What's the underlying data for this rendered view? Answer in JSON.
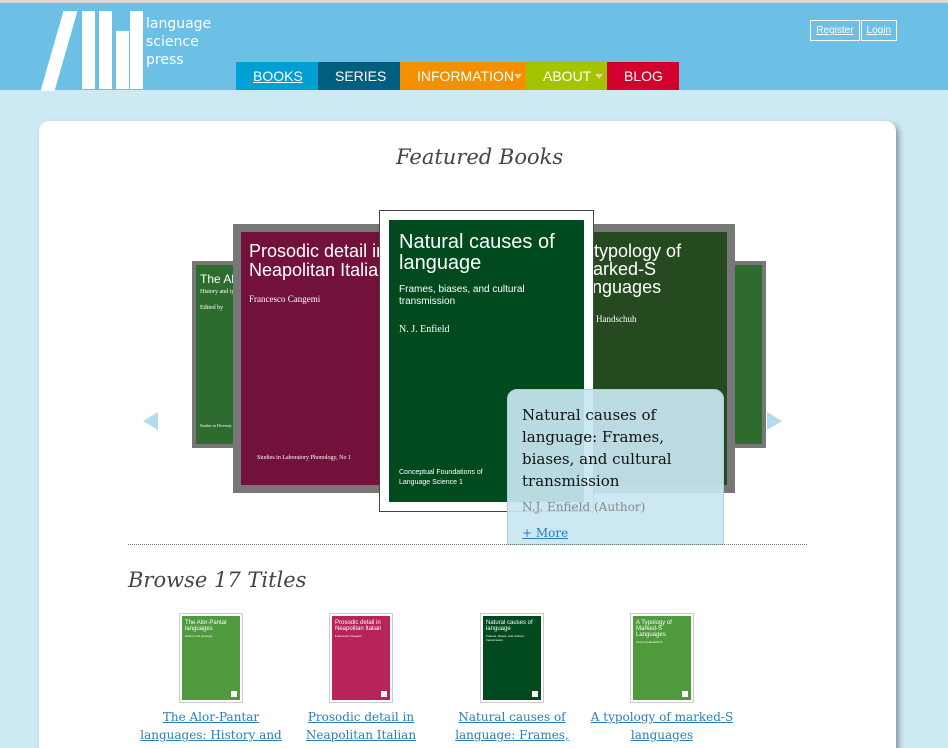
{
  "brand": {
    "line1": "language",
    "line2": "science",
    "line3": "press"
  },
  "account": {
    "register": "Register",
    "login": "Login"
  },
  "nav": [
    {
      "label": "BOOKS",
      "color": "#009fd4",
      "active": true
    },
    {
      "label": "SERIES",
      "color": "#005f7f"
    },
    {
      "label": "INFORMATION",
      "color": "#f39000"
    },
    {
      "label": "ABOUT",
      "color": "#a5c400"
    },
    {
      "label": "BLOG",
      "color": "#d3002d"
    }
  ],
  "featured": {
    "title": "Featured Books",
    "books": [
      {
        "title": "The Alor-Pantar languages",
        "subtitle": "History and typology",
        "editor": "Edited by",
        "series": "Studies in Diversity",
        "color": "#2e6b2e"
      },
      {
        "title": "Prosodic detail in Neapolitan Italian",
        "author": "Francesco Cangemi",
        "series": "Studies in Laboratory Phonology, No 1",
        "color": "#72123a"
      },
      {
        "title": "Natural causes of language",
        "subtitle": "Frames, biases, and cultural transmission",
        "author": "N. J. Enfield",
        "series": "Conceptual Foundations of Language Science 1",
        "color": "#004a1e"
      },
      {
        "title": "A typology of Marked-S languages",
        "author": "Handschuh",
        "color": "#264a20"
      },
      {
        "color": "#2e6b2e"
      }
    ],
    "tooltip": {
      "title": "Natural causes of language: Frames, biases, and cultural transmission",
      "author": "N.J. Enfield (Author)",
      "more": "+ More"
    }
  },
  "browse": {
    "title": "Browse 17 Titles",
    "items": [
      {
        "cover_title": "The Alor-Pantar languages",
        "cover_sub": "History and typology",
        "link": "The Alor-Pantar languages: History and",
        "color": "#4f9a3c"
      },
      {
        "cover_title": "Prosodic detail in Neapolitan Italian",
        "cover_sub": "Francesco Cangemi",
        "link": "Prosodic detail in Neapolitan Italian",
        "color": "#b8245a"
      },
      {
        "cover_title": "Natural causes of language",
        "cover_sub": "Frames, biases, and cultural transmission",
        "link": "Natural causes of language: Frames,",
        "color": "#004a1e"
      },
      {
        "cover_title": "A Typology of Marked-S Languages",
        "cover_sub": "Corinna Handschuh",
        "link": "A typology of marked-S languages",
        "color": "#4f9a3c"
      }
    ]
  },
  "colors": {
    "header": "#6cc0e5",
    "background": "#cce9f4",
    "link": "#2a7db8"
  }
}
